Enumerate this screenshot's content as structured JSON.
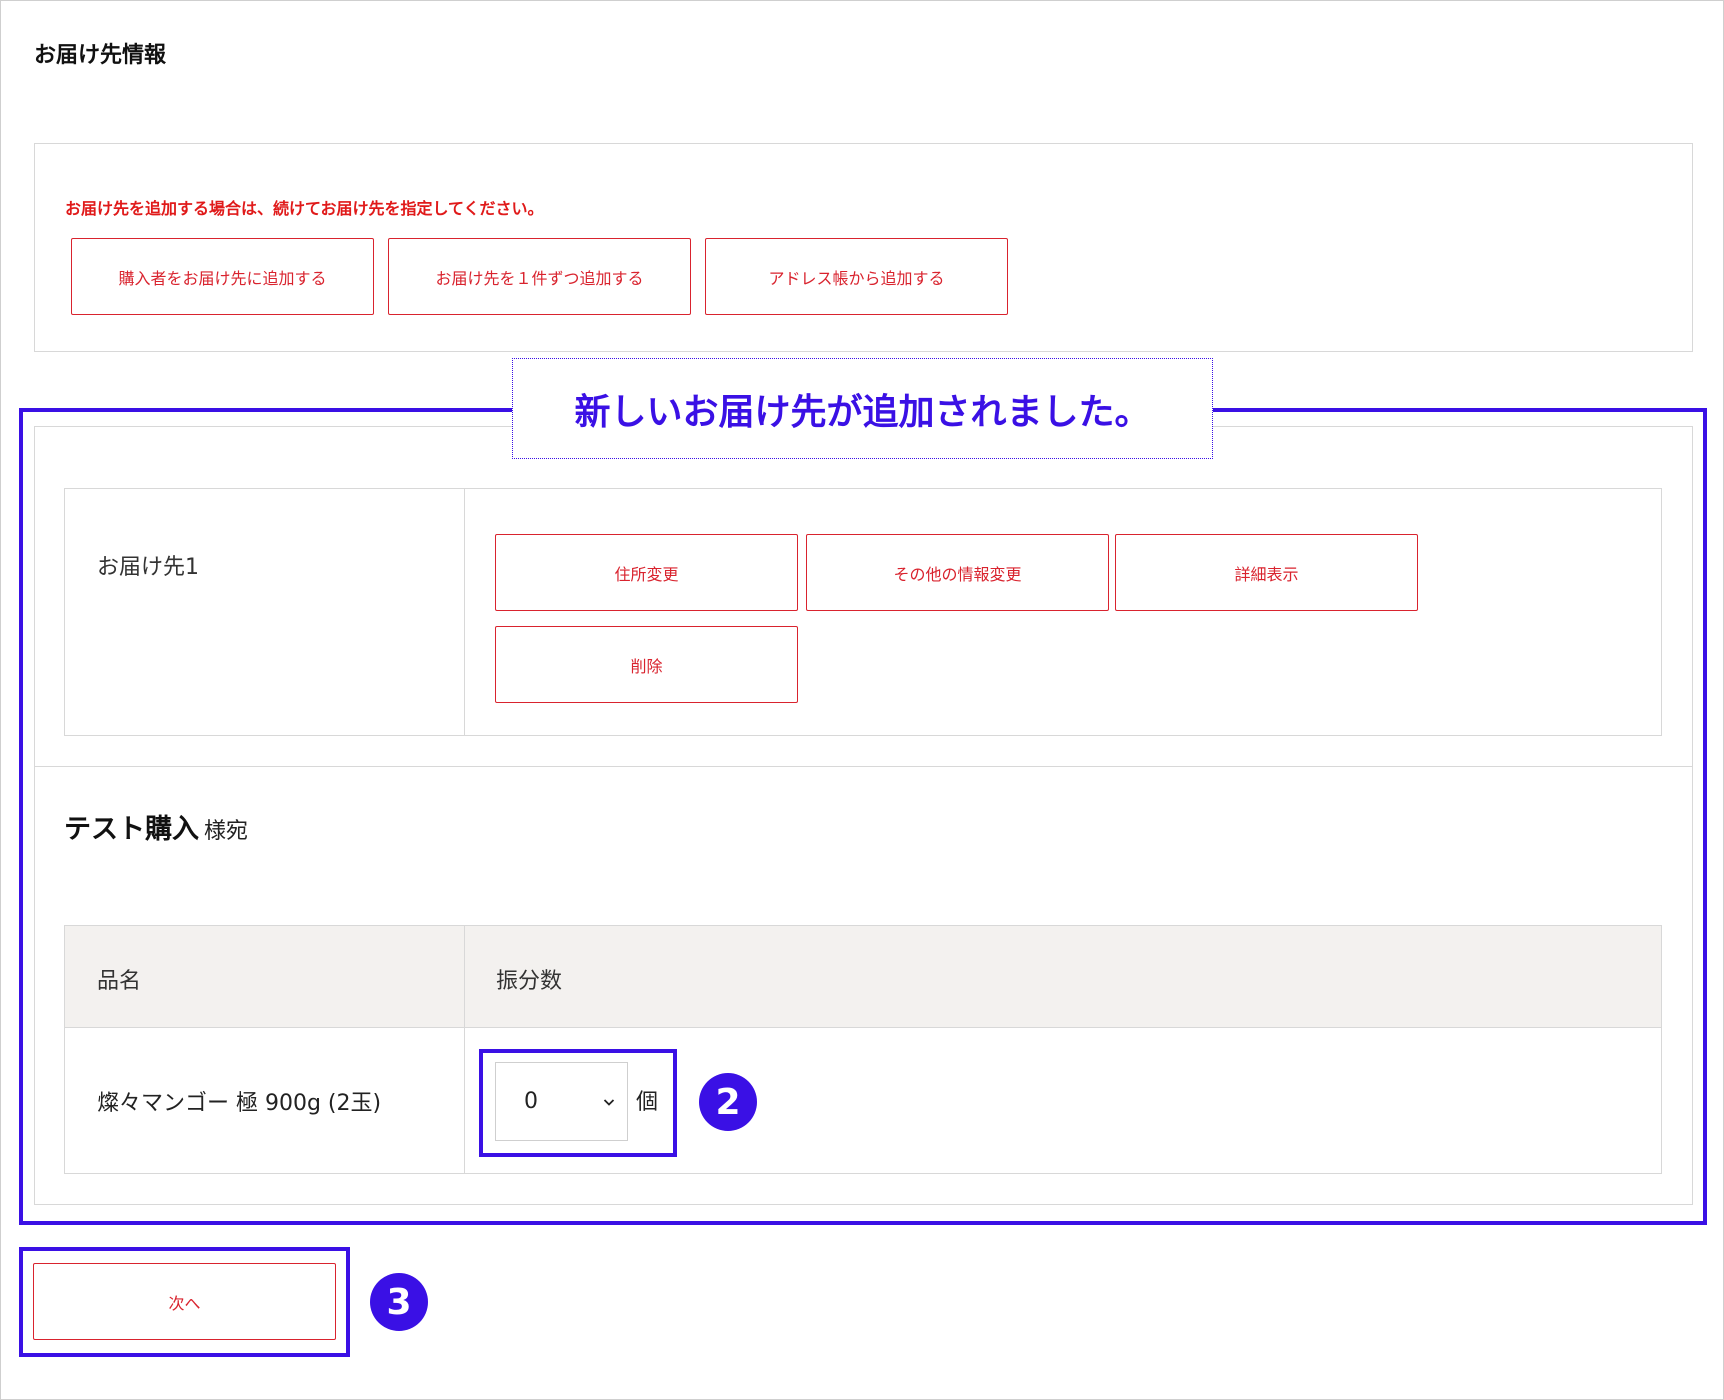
{
  "page": {
    "title": "お届け先情報"
  },
  "add_panel": {
    "notice": "お届け先を追加する場合は、続けてお届け先を指定してください。",
    "buttons": [
      "購入者をお届け先に追加する",
      "お届け先を１件ずつ追加する",
      "アドレス帳から追加する"
    ]
  },
  "callout": {
    "text": "新しいお届け先が追加されました。"
  },
  "destination": {
    "label": "お届け先1",
    "buttons": {
      "address": "住所変更",
      "other": "その他の情報変更",
      "detail": "詳細表示",
      "delete": "削除"
    }
  },
  "recipient": {
    "name": "テスト購入",
    "suffix": "様宛"
  },
  "items_table": {
    "headers": {
      "name": "品名",
      "qty": "振分数"
    },
    "rows": [
      {
        "name": "燦々マンゴー 極 900g (2玉)",
        "qty_value": "0",
        "unit": "個"
      }
    ]
  },
  "badges": {
    "qty_step": "2",
    "next_step": "3"
  },
  "footer": {
    "next_label": "次へ"
  },
  "colors": {
    "accent_red": "#d9232e",
    "highlight_blue": "#3a10e5",
    "table_header_bg": "#f3f1ef"
  }
}
